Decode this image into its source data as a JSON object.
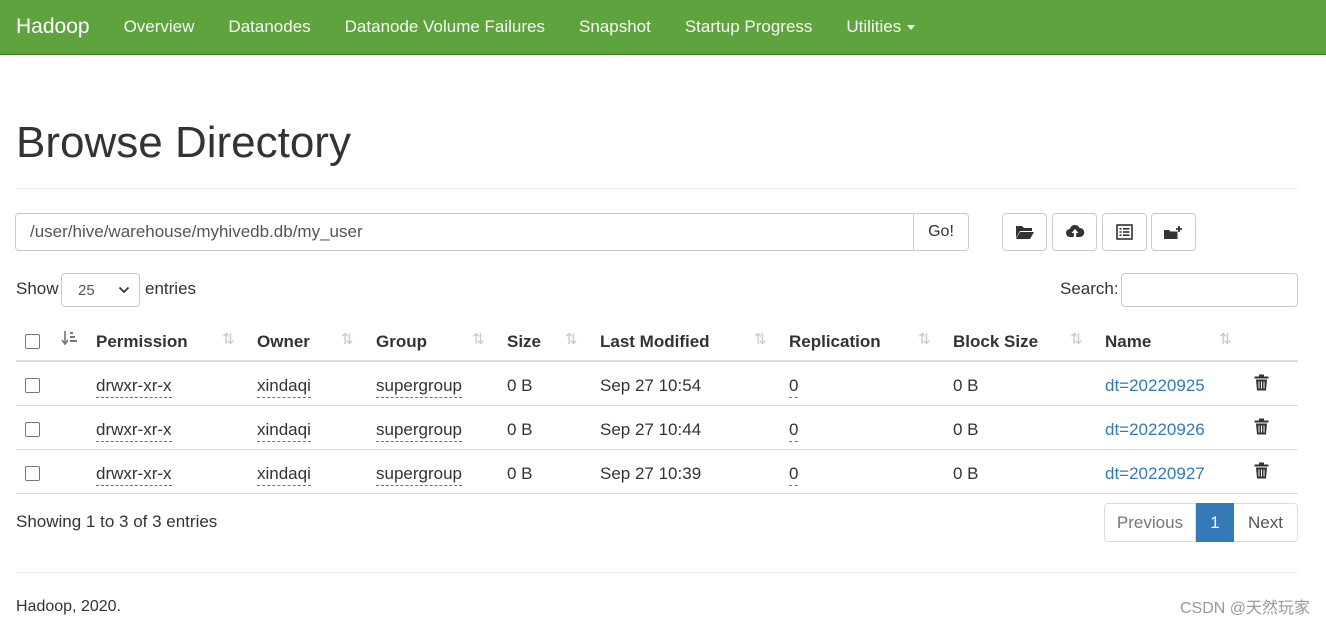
{
  "navbar": {
    "brand": "Hadoop",
    "items": [
      "Overview",
      "Datanodes",
      "Datanode Volume Failures",
      "Snapshot",
      "Startup Progress",
      "Utilities"
    ],
    "bg_color": "#5fa33e"
  },
  "page": {
    "title": "Browse Directory"
  },
  "path_bar": {
    "value": "/user/hive/warehouse/myhivedb.db/my_user",
    "go_label": "Go!"
  },
  "toolbar_icons": [
    "folder-open-icon",
    "cloud-upload-icon",
    "list-alt-icon",
    "folder-plus-icon"
  ],
  "table_controls": {
    "show_label": "Show",
    "entries_value": "25",
    "entries_label": "entries",
    "search_label": "Search:"
  },
  "table": {
    "columns": [
      "Permission",
      "Owner",
      "Group",
      "Size",
      "Last Modified",
      "Replication",
      "Block Size",
      "Name"
    ],
    "rows": [
      {
        "permission": "drwxr-xr-x",
        "owner": "xindaqi",
        "group": "supergroup",
        "size": "0 B",
        "modified": "Sep 27 10:54",
        "replication": "0",
        "block_size": "0 B",
        "name": "dt=20220925"
      },
      {
        "permission": "drwxr-xr-x",
        "owner": "xindaqi",
        "group": "supergroup",
        "size": "0 B",
        "modified": "Sep 27 10:44",
        "replication": "0",
        "block_size": "0 B",
        "name": "dt=20220926"
      },
      {
        "permission": "drwxr-xr-x",
        "owner": "xindaqi",
        "group": "supergroup",
        "size": "0 B",
        "modified": "Sep 27 10:39",
        "replication": "0",
        "block_size": "0 B",
        "name": "dt=20220927"
      }
    ]
  },
  "info": {
    "showing": "Showing 1 to 3 of 3 entries"
  },
  "pagination": {
    "previous": "Previous",
    "current": "1",
    "next": "Next",
    "accent_color": "#337ab7"
  },
  "footer": {
    "text": "Hadoop, 2020."
  },
  "watermark": {
    "text": "CSDN @天然玩家"
  }
}
